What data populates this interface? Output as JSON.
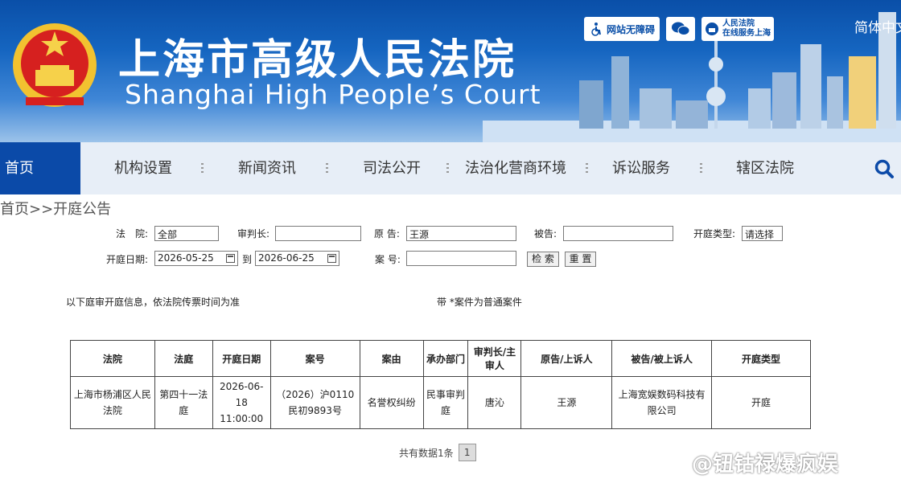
{
  "header": {
    "title_cn": "上海市高级人民法院",
    "title_en": "Shanghai High People’s Court",
    "accessibility_label": "网站无障碍",
    "online_service_line1": "人民法院",
    "online_service_line2": "在线服务上海",
    "language": "简体中文"
  },
  "nav": {
    "items": [
      "首页",
      "机构设置",
      "新闻资讯",
      "司法公开",
      "法治化营商环境",
      "诉讼服务",
      "辖区法院"
    ],
    "active_index": 0
  },
  "breadcrumb": "首页>>开庭公告",
  "form": {
    "court_label": "法　院:",
    "court_value": "全部",
    "judge_label": "审判长:",
    "judge_value": "",
    "plaintiff_label": "原 告:",
    "plaintiff_value": "王源",
    "defendant_label": "被告:",
    "defendant_value": "",
    "type_label": "开庭类型:",
    "type_value": "请选择",
    "date_label": "开庭日期:",
    "date_from": "2026-05-25",
    "date_to_label": "到",
    "date_to": "2026-06-25",
    "case_no_label": "案 号:",
    "case_no_value": "",
    "search_button": "检 索",
    "reset_button": "重 置"
  },
  "notes": {
    "left": "以下庭审开庭信息，依法院传票时间为准",
    "right": "带 *案件为普通案件"
  },
  "table": {
    "headers": [
      "法院",
      "法庭",
      "开庭日期",
      "案号",
      "案由",
      "承办部门",
      "审判长/主审人",
      "原告/上诉人",
      "被告/被上诉人",
      "开庭类型"
    ],
    "rows": [
      [
        "上海市杨浦区人民法院",
        "第四十一法庭",
        "2026-06-18 11:00:00",
        "（2026）沪0110民初9893号",
        "名誉权纠纷",
        "民事审判庭",
        "唐沁",
        "王源",
        "上海宽娱数码科技有限公司",
        "开庭"
      ]
    ]
  },
  "pager": {
    "total_text": "共有数据1条",
    "current_page": "1"
  },
  "watermark": "@钮钴禄爆疯娱",
  "colors": {
    "brand_blue": "#0b4aa8",
    "nav_bg": "#e7eef7"
  }
}
